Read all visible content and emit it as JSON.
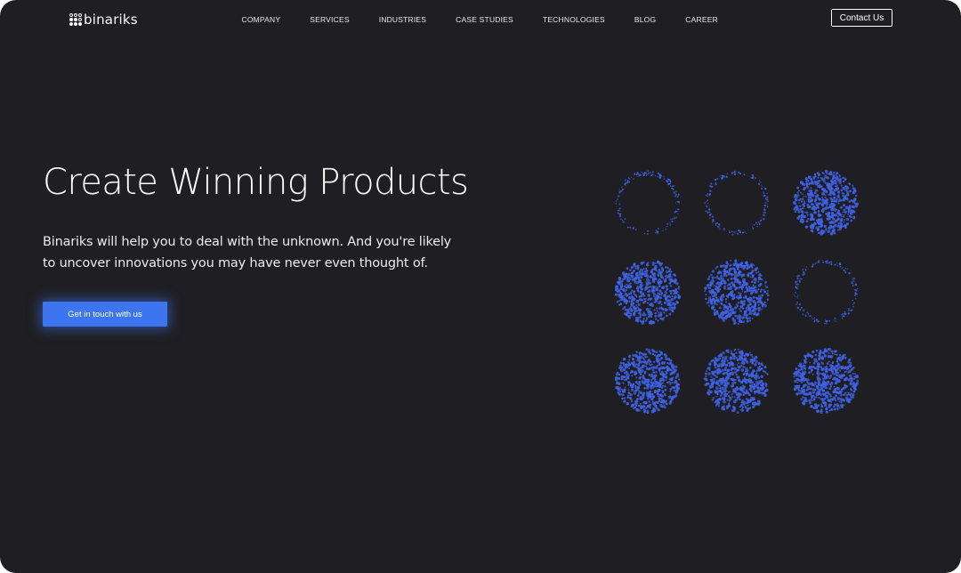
{
  "brand": {
    "name": "binariks",
    "accent": "#3d74f0",
    "dot_color": "#3f63e6",
    "background": "#1f1e22"
  },
  "nav": {
    "items": [
      {
        "label": "COMPANY"
      },
      {
        "label": "SERVICES"
      },
      {
        "label": "INDUSTRIES"
      },
      {
        "label": "CASE STUDIES"
      },
      {
        "label": "TECHNOLOGIES"
      },
      {
        "label": "BLOG"
      },
      {
        "label": "CAREER"
      }
    ],
    "contact_label": "Contact Us"
  },
  "hero": {
    "title": "Create Winning Products",
    "subtitle": "Binariks will help you to deal with the unknown. And you're likely to uncover innovations you may have never even thought of.",
    "cta_label": "Get in touch with us"
  },
  "illustration": {
    "icon": "particle-circles",
    "rows": [
      [
        "ring",
        "ring",
        "filled"
      ],
      [
        "filled",
        "filled",
        "ring"
      ],
      [
        "filled",
        "filled",
        "filled"
      ]
    ]
  }
}
